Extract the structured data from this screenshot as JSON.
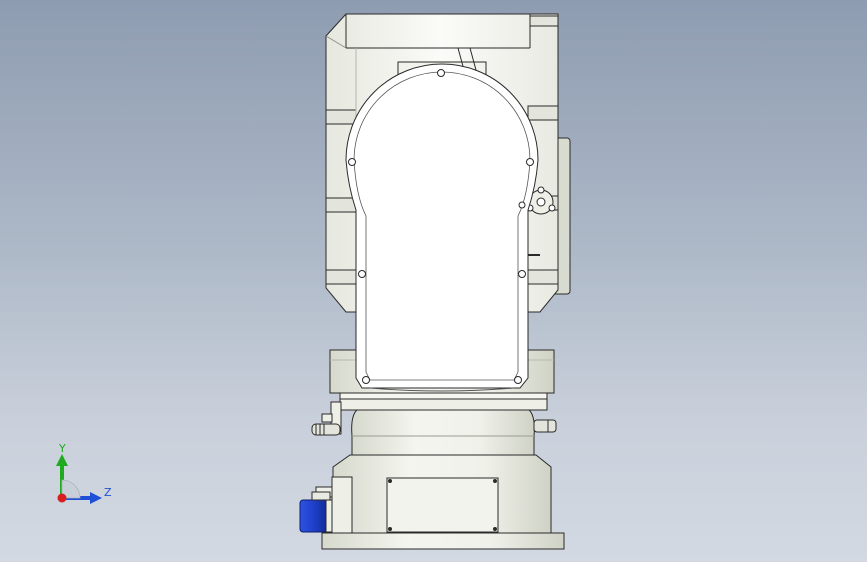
{
  "viewport": {
    "background_top": "#8e9cb1",
    "background_bottom": "#d3d9e2"
  },
  "model": {
    "subject": "robot-arm-model",
    "body_color": "#f7f7f3",
    "shade_color": "#e3e5dc",
    "line_color": "#2a2a2a",
    "motor_color": "#1f3fc9"
  },
  "triad": {
    "y_label": "Y",
    "z_label": "Z",
    "y_color": "#1faa1f",
    "z_color": "#1f4fd8",
    "x_color": "#d81f1f"
  }
}
